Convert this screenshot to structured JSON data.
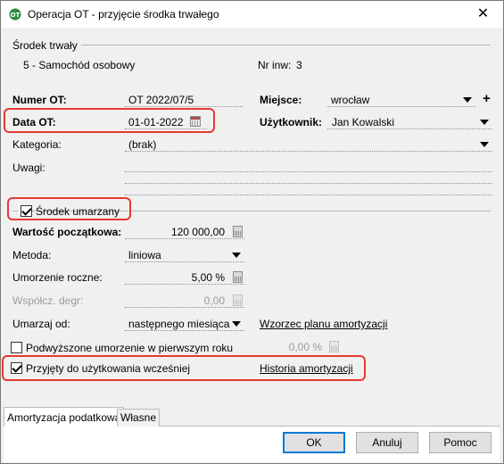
{
  "window": {
    "title": "Operacja OT - przyjęcie środka trwałego",
    "close_symbol": "✕",
    "app_icon": "ot-app-icon"
  },
  "srodek": {
    "section_label": "Środek trwały",
    "name": "5 - Samochód osobowy",
    "nr_inw_label": "Nr inw:",
    "nr_inw_value": "3"
  },
  "fields": {
    "numer_ot_label": "Numer OT:",
    "numer_ot_value": "OT 2022/07/5",
    "data_ot_label": "Data OT:",
    "data_ot_value": "01-01-2022",
    "miejsce_label": "Miejsce:",
    "miejsce_value": "wrocław",
    "uzytkownik_label": "Użytkownik:",
    "uzytkownik_value": "Jan Kowalski",
    "kategoria_label": "Kategoria:",
    "kategoria_value": "(brak)",
    "uwagi_label": "Uwagi:",
    "uwagi_value": ""
  },
  "amortyzacja": {
    "section_label": "Środek umarzany",
    "section_checked": true,
    "wartosc_label": "Wartość początkowa:",
    "wartosc_value": "120 000,00",
    "metoda_label": "Metoda:",
    "metoda_value": "liniowa",
    "umorzenie_label": "Umorzenie roczne:",
    "umorzenie_value": "5,00 %",
    "wspolcz_label": "Współcz. degr:",
    "wspolcz_value": "0,00",
    "umarzaj_label": "Umarzaj od:",
    "umarzaj_value": "następnego miesiąca",
    "wzorzec_link": "Wzorzec planu amortyzacji",
    "podwyzszone_label": "Podwyższone umorzenie w pierwszym roku",
    "podwyzszone_checked": false,
    "podwyzszone_value": "0,00 %",
    "przyjety_label": "Przyjęty do użytkowania wcześniej",
    "przyjety_checked": true,
    "historia_link": "Historia amortyzacji"
  },
  "tabs": [
    {
      "label": "Amortyzacja podatkowa",
      "active": true
    },
    {
      "label": "Własne",
      "active": false
    }
  ],
  "buttons": {
    "ok": "OK",
    "cancel": "Anuluj",
    "help": "Pomoc"
  },
  "colors": {
    "highlight": "#e53935",
    "default_button_border": "#0078d7"
  }
}
